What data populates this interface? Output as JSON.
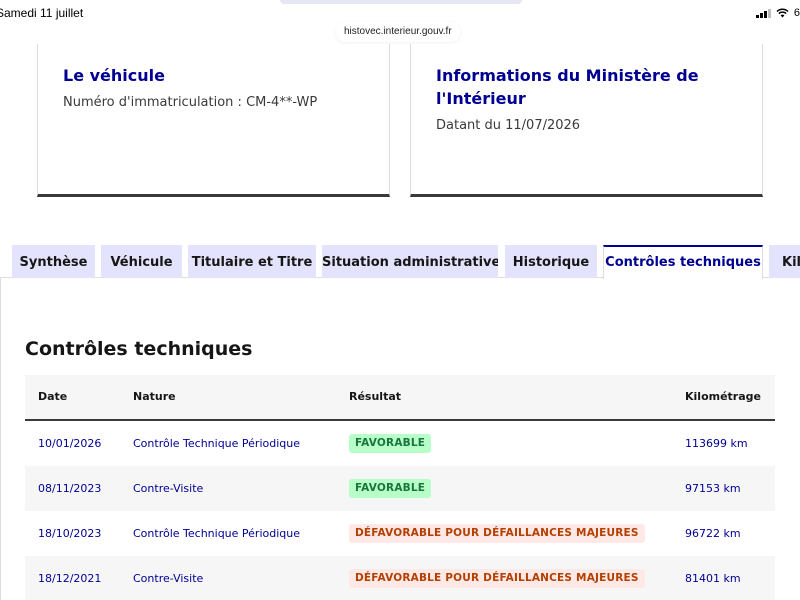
{
  "status_bar": {
    "time_date": "Samedi 11 juillet",
    "battery": "6"
  },
  "browser": {
    "url": "histovec.interieur.gouv.fr"
  },
  "cards": {
    "vehicule": {
      "title": "Le véhicule",
      "text": "Numéro d'immatriculation : CM-4**-WP"
    },
    "ministere": {
      "title_line1": "Informations du Ministère de",
      "title_line2": "l'Intérieur",
      "text": "Datant du 11/07/2026"
    }
  },
  "tabs": [
    {
      "label": "Synthèse",
      "active": false
    },
    {
      "label": "Véhicule",
      "active": false
    },
    {
      "label": "Titulaire et Titre",
      "active": false
    },
    {
      "label": "Situation administrative",
      "active": false
    },
    {
      "label": "Historique",
      "active": false
    },
    {
      "label": "Contrôles techniques",
      "active": true
    },
    {
      "label": "Kil",
      "active": false
    }
  ],
  "section": {
    "title": "Contrôles techniques"
  },
  "table": {
    "headers": {
      "date": "Date",
      "nature": "Nature",
      "result": "Résultat",
      "km": "Kilométrage"
    },
    "rows": [
      {
        "date": "10/01/2026",
        "nature": "Contrôle Technique Périodique",
        "result": "FAVORABLE",
        "status": "ok",
        "km": "113699 km"
      },
      {
        "date": "08/11/2023",
        "nature": "Contre-Visite",
        "result": "FAVORABLE",
        "status": "ok",
        "km": "97153 km"
      },
      {
        "date": "18/10/2023",
        "nature": "Contrôle Technique Périodique",
        "result": "DÉFAVORABLE POUR DÉFAILLANCES MAJEURES",
        "status": "ko",
        "km": "96722 km"
      },
      {
        "date": "18/12/2021",
        "nature": "Contre-Visite",
        "result": "DÉFAVORABLE POUR DÉFAILLANCES MAJEURES",
        "status": "ko",
        "km": "81401 km"
      }
    ]
  },
  "colors": {
    "primary_blue": "#000091",
    "tab_bg": "#e3e3fd",
    "success_bg": "#b8fec9",
    "success_text": "#18753c",
    "error_bg": "#ffe9e6",
    "error_text": "#b34000"
  },
  "icons": [
    "wifi-icon",
    "signal-icon"
  ]
}
